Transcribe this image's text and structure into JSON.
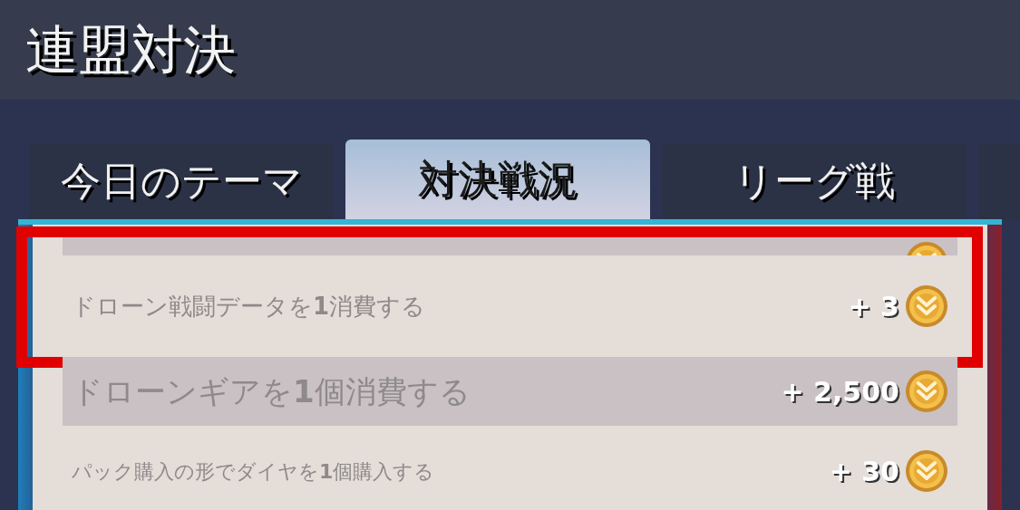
{
  "header": {
    "title": "連盟対決"
  },
  "tabs": [
    {
      "label": "今日のテーマ",
      "selected": false
    },
    {
      "label": "対決戦況",
      "selected": true
    },
    {
      "label": "リーグ戦",
      "selected": false
    },
    {
      "selected": false
    }
  ],
  "rows": [
    {
      "shaded": true,
      "highlighted": false
    },
    {
      "text": "ドローン戦闘データを**1**消費する",
      "points": "+ 3",
      "shaded": false,
      "highlighted": true
    },
    {
      "text": "ドローンギアを**1**個消費する",
      "points": "+ 2,500",
      "shaded": true,
      "highlighted": false
    },
    {
      "text": "パック購入の形でダイヤを**1**個購入する",
      "points": "+ 30",
      "shaded": false,
      "highlighted": false
    }
  ]
}
